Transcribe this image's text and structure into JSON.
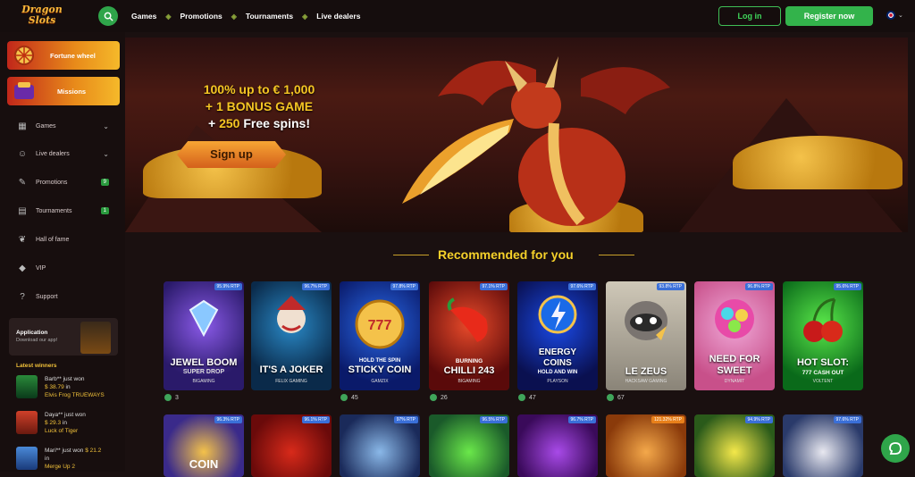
{
  "header": {
    "logo_line1": "Dragon",
    "logo_line2": "Slots",
    "nav": [
      "Games",
      "Promotions",
      "Tournaments",
      "Live dealers"
    ],
    "login_label": "Log in",
    "register_label": "Register now",
    "lang_icon": "uk-flag-icon"
  },
  "sidebar": {
    "promo_cards": [
      {
        "label": "Fortune wheel",
        "icon": "fortune-wheel-icon"
      },
      {
        "label": "Missions",
        "icon": "missions-icon"
      }
    ],
    "items": [
      {
        "label": "Games",
        "icon": "games-icon",
        "chevron": true
      },
      {
        "label": "Live dealers",
        "icon": "live-dealers-icon",
        "chevron": true
      },
      {
        "label": "Promotions",
        "icon": "promotions-icon",
        "badge": "9"
      },
      {
        "label": "Tournaments",
        "icon": "tournaments-icon",
        "badge": "1"
      },
      {
        "label": "Hall of fame",
        "icon": "laurel-icon"
      },
      {
        "label": "VIP",
        "icon": "diamond-icon"
      },
      {
        "label": "Support",
        "icon": "support-icon"
      }
    ],
    "app": {
      "title": "Application",
      "subtitle": "Download our app!"
    },
    "winners_title": "Latest winners",
    "winners": [
      {
        "name": "Barb**",
        "action": "just won",
        "amount": "$ 38.79",
        "prep": "in",
        "game": "Elvis Frog TRUEWAYS"
      },
      {
        "name": "Daya**",
        "action": "just won",
        "amount": "$ 29.3",
        "prep": "in",
        "game": "Luck of Tiger"
      },
      {
        "name": "Mari**",
        "action": "just won",
        "amount": "$ 21.2",
        "prep": "in",
        "game": "Merge Up 2"
      }
    ]
  },
  "hero": {
    "line1_pre": "100% up to",
    "line1_val": "€ 1,000",
    "line2": "+ 1 BONUS GAME",
    "line3_pre": "+",
    "line3_val": "250",
    "line3_post": "Free spins!",
    "cta": "Sign up"
  },
  "recommended": {
    "title": "Recommended for you",
    "games": [
      {
        "title": "JEWEL BOOM",
        "sub": "SUPER DROP",
        "provider": "BIGAMING",
        "rtp": "95.9% RTP",
        "players": "3"
      },
      {
        "title": "IT'S A JOKER",
        "sub": "",
        "provider": "FELIX GAMING",
        "rtp": "96.7% RTP",
        "players": ""
      },
      {
        "title": "STICKY COIN",
        "sub": "HOLD THE SPIN",
        "provider": "GAMZIX",
        "rtp": "97.8% RTP",
        "players": "45"
      },
      {
        "title": "CHILLI 243",
        "sub": "BURNING",
        "provider": "BIGAMING",
        "rtp": "97.1% RTP",
        "players": "26"
      },
      {
        "title": "COINS",
        "sub": "ENERGY",
        "extra": "HOLD AND WIN",
        "provider": "PLAYSON",
        "rtp": "97.6% RTP",
        "players": "47"
      },
      {
        "title": "LE ZEUS",
        "sub": "",
        "provider": "HACKSAW GAMING",
        "rtp": "93.8% RTP",
        "players": "67"
      },
      {
        "title": "SWEET",
        "sub": "NEED FOR",
        "provider": "DYNAMIT",
        "rtp": "96.8% RTP",
        "players": ""
      },
      {
        "title": "HOT SLOT:",
        "sub": "777 CASH OUT",
        "provider": "VOLTENT",
        "rtp": "95.6% RTP",
        "players": ""
      }
    ],
    "row2_rtp": [
      "96.3% RTP",
      "96.1% RTP",
      "97% RTP",
      "96.5% RTP",
      "96.7% RTP",
      "121.32% RTP",
      "94.9% RTP",
      "97.6% RTP"
    ],
    "row2_first_title": "COIN"
  },
  "colors": {
    "accent_green": "#33b34b",
    "gold": "#f5c623",
    "bg": "#1a1010"
  }
}
